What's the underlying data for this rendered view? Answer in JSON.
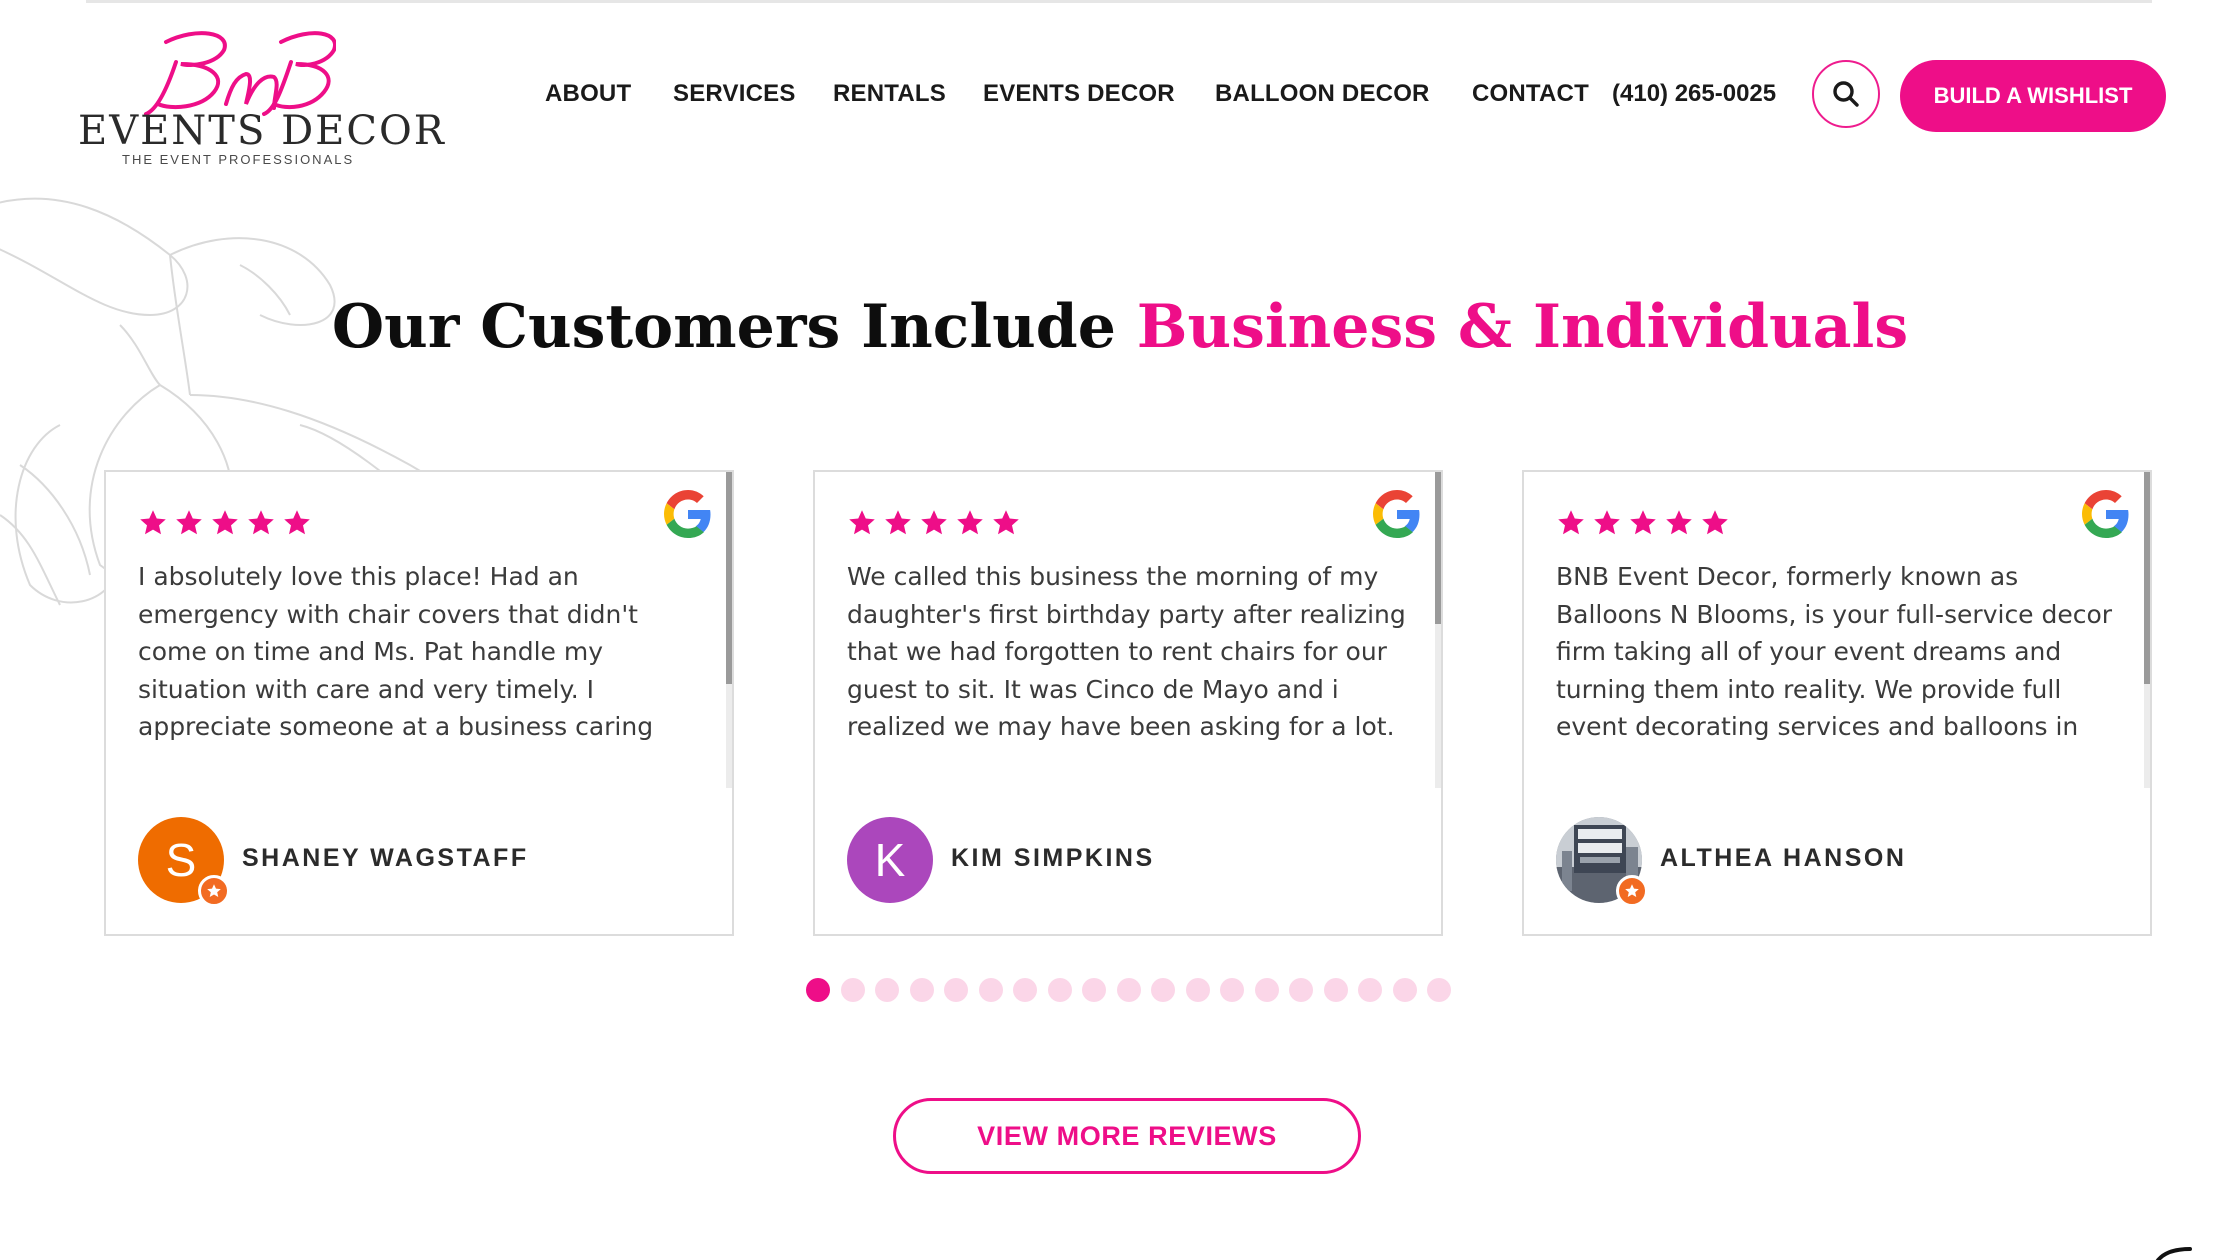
{
  "brand": {
    "script": "BnB",
    "wordmark": "EVENTS DECOR",
    "tagline": "THE EVENT PROFESSIONALS"
  },
  "nav": {
    "items": [
      "ABOUT",
      "SERVICES",
      "RENTALS",
      "EVENTS DECOR",
      "BALLOON DECOR",
      "CONTACT"
    ],
    "phone": "(410) 265-0025",
    "search_icon": "search-icon",
    "wishlist_label": "BUILD A WISHLIST"
  },
  "section": {
    "heading_main": "Our Customers Include ",
    "heading_accent": "Business & Individuals"
  },
  "reviews": [
    {
      "rating": 5,
      "text": "I absolutely love this place! Had an emergency with chair covers that didn't come on time and Ms. Pat handle my situation with care and very timely. I appreciate someone at a business caring enough for their customers and go above",
      "initial": "S",
      "name": "SHANEY WAGSTAFF",
      "avatar_color": "#ef6c00"
    },
    {
      "rating": 5,
      "text": "We called this business the morning of my daughter's first birthday party after realizing that we had forgotten to rent chairs for our guest to sit. It was Cinco de Mayo and i realized we may have been asking for a lot. Wendy answered our call, took a second to",
      "initial": "K",
      "name": "KIM SIMPKINS",
      "avatar_color": "#ab47bc"
    },
    {
      "rating": 5,
      "text": "BNB Event Decor, formerly known as Balloons N Blooms, is your full-service decor firm taking all of your event dreams and turning them into reality. We provide full event decorating services and balloons in the metropolitan area of Baltimore,",
      "initial": "",
      "name": "ALTHEA HANSON",
      "avatar_color": "#8a8f96"
    }
  ],
  "pagination": {
    "count": 19,
    "active": 0
  },
  "view_more_label": "VIEW MORE REVIEWS",
  "colors": {
    "accent": "#ee0e88",
    "dot_inactive": "#fbd6e8",
    "star": "#ee0e88"
  }
}
